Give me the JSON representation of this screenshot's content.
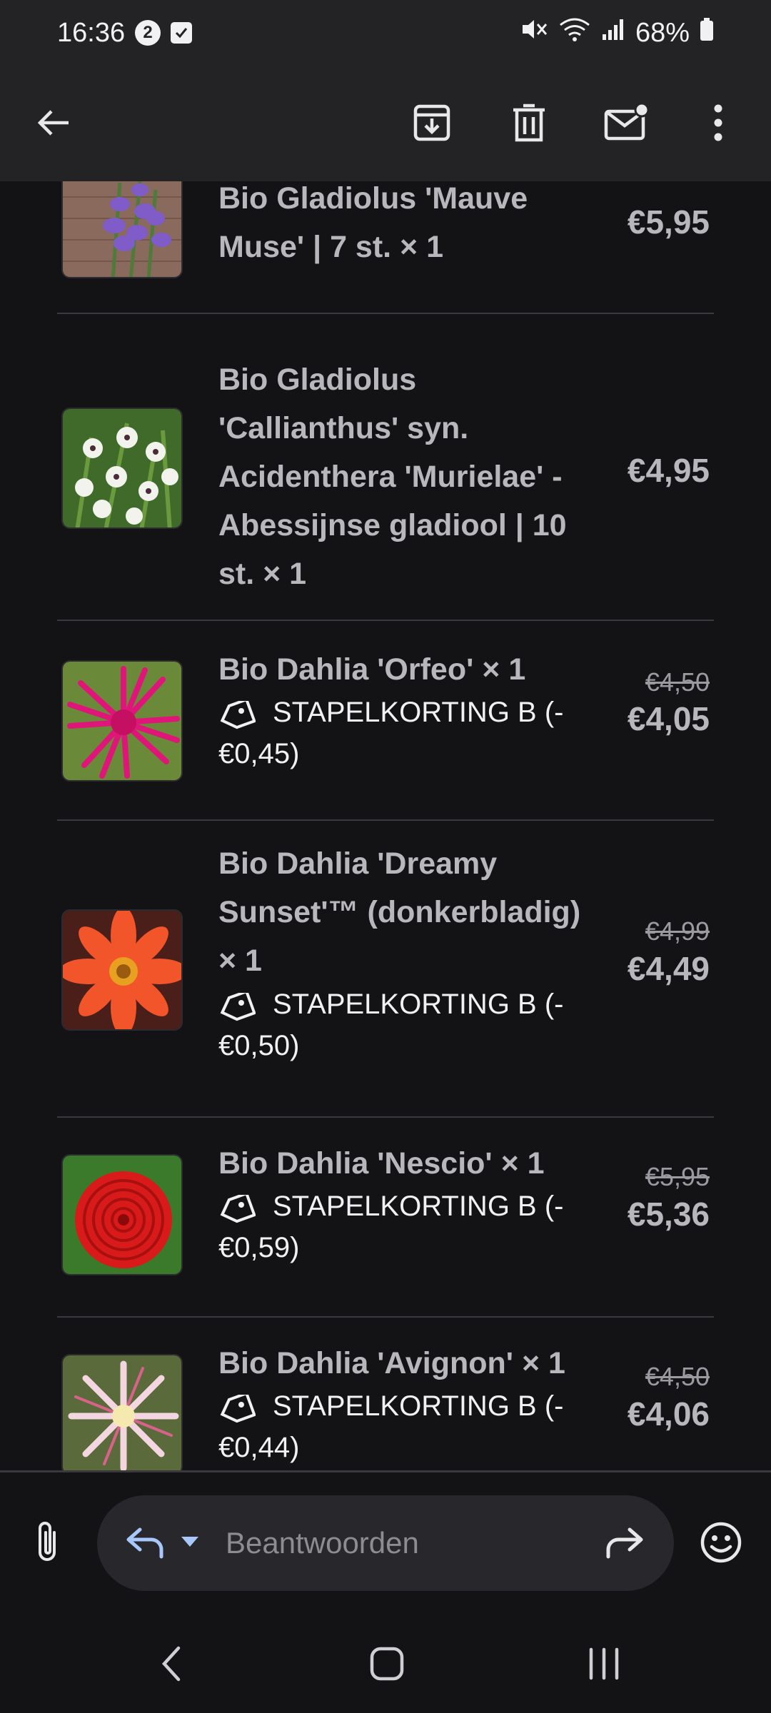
{
  "status_bar": {
    "time": "16:36",
    "notif_count": "2",
    "battery": "68%"
  },
  "items": [
    {
      "title": "Bio Gladiolus 'Mauve Muse' | 7 st. × 1",
      "price": "€5,95",
      "image": "purple-gladiolus-image"
    },
    {
      "title": "Bio Gladiolus 'Callianthus' syn. Acidenthera 'Murielae' - Abessijnse gladiool | 10 st. × 1",
      "price": "€4,95",
      "image": "white-gladiolus-image"
    },
    {
      "title": "Bio Dahlia 'Orfeo' × 1",
      "discount": "STAPELKORTING B (-€0,45)",
      "price_old": "€4,50",
      "price": "€4,05",
      "image": "pink-dahlia-image"
    },
    {
      "title": "Bio Dahlia 'Dreamy Sunset'™ (donkerbladig) × 1",
      "discount": "STAPELKORTING B (-€0,50)",
      "price_old": "€4,99",
      "price": "€4,49",
      "image": "orange-dahlia-image"
    },
    {
      "title": "Bio Dahlia 'Nescio' × 1",
      "discount": "STAPELKORTING B (-€0,59)",
      "price_old": "€5,95",
      "price": "€5,36",
      "image": "red-dahlia-image"
    },
    {
      "title": "Bio Dahlia 'Avignon' × 1",
      "discount": "STAPELKORTING B (-€0,44)",
      "price_old": "€4,50",
      "price": "€4,06",
      "image": "white-pink-dahlia-image"
    }
  ],
  "reply": {
    "placeholder": "Beantwoorden"
  },
  "colors": {
    "background": "#131316",
    "app_bar": "#232326",
    "divider": "#3a3a3e",
    "reply_pill": "#27272c",
    "reply_accent": "#a8c7fa"
  },
  "icons": {
    "app_bar": [
      "back-arrow-icon",
      "archive-icon",
      "delete-icon",
      "mark-unread-icon",
      "more-vert-icon"
    ],
    "reply_bar": [
      "attachment-icon",
      "reply-icon",
      "reply-dropdown-icon",
      "forward-icon",
      "emoji-icon"
    ],
    "nav": [
      "nav-back-icon",
      "nav-home-icon",
      "nav-recents-icon"
    ]
  }
}
